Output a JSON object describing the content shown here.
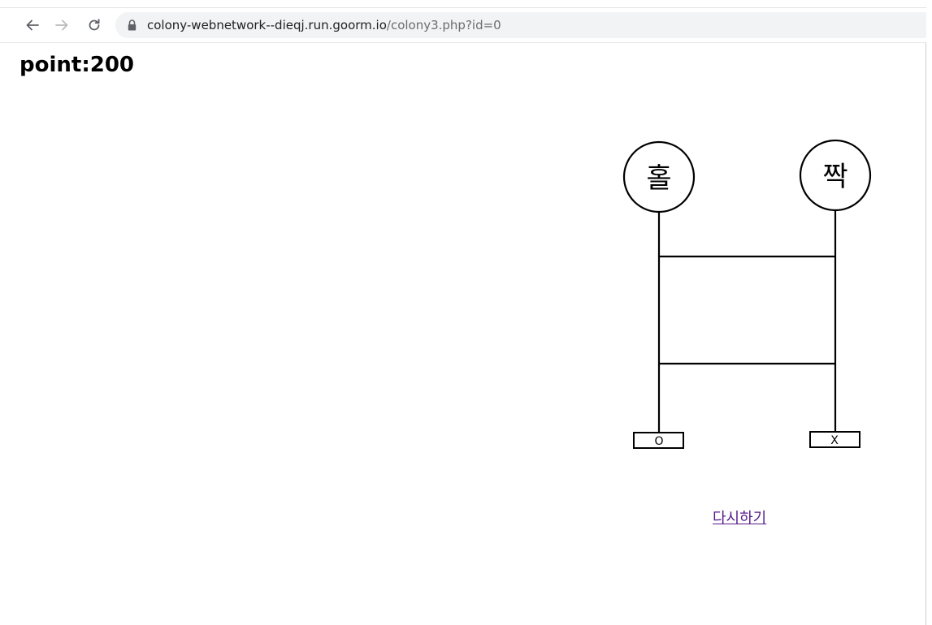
{
  "browser": {
    "back_icon": "arrow-left-icon",
    "forward_icon": "arrow-right-icon",
    "reload_icon": "reload-icon",
    "lock_icon": "lock-icon",
    "url_host": "colony-webnetwork--dieqj.run.goorm.io",
    "url_path": "/colony3.php?id=0"
  },
  "page": {
    "title": "point:200"
  },
  "ladder": {
    "start_labels": [
      "홀",
      "짝"
    ],
    "end_labels": [
      "O",
      "X"
    ]
  },
  "actions": {
    "restart_label": "다시하기"
  }
}
